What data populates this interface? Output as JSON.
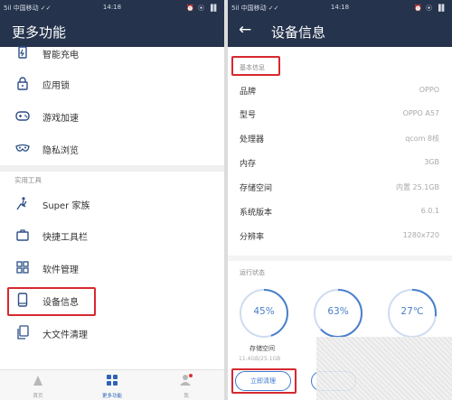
{
  "statusbar": {
    "carrier": "5il 中国移动 ✓✓",
    "time": "14:18",
    "icons": "⏰ ⦿ ▐▌"
  },
  "left": {
    "title": "更多功能",
    "items_top": [
      {
        "icon": "charge-icon",
        "label": "智能充电"
      },
      {
        "icon": "lock-icon",
        "label": "应用锁"
      },
      {
        "icon": "gamepad-icon",
        "label": "游戏加速"
      },
      {
        "icon": "mask-icon",
        "label": "隐私浏览"
      }
    ],
    "section": "实用工具",
    "items_tools": [
      {
        "icon": "family-icon",
        "label": "Super 家族"
      },
      {
        "icon": "toolbox-icon",
        "label": "快捷工具栏"
      },
      {
        "icon": "grid-icon",
        "label": "软件管理"
      },
      {
        "icon": "phone-icon",
        "label": "设备信息"
      },
      {
        "icon": "files-icon",
        "label": "大文件清理"
      }
    ],
    "bottom_nav": [
      {
        "icon": "home-icon",
        "label": "首页"
      },
      {
        "icon": "apps-icon",
        "label": "更多功能"
      },
      {
        "icon": "user-icon",
        "label": "我"
      }
    ],
    "colors": {
      "header": "#25334c",
      "accent": "#2d63b8",
      "highlight": "#d7282f"
    }
  },
  "right": {
    "title": "设备信息",
    "back_icon": "back-arrow-icon",
    "basic_label": "基本信息",
    "rows": [
      {
        "key": "品牌",
        "value": "OPPO"
      },
      {
        "key": "型号",
        "value": "OPPO A57"
      },
      {
        "key": "处理器",
        "value": "qcom 8核"
      },
      {
        "key": "内存",
        "value": "3GB"
      },
      {
        "key": "存储空间",
        "value": "内置 25.1GB"
      },
      {
        "key": "系统版本",
        "value": "6.0.1"
      },
      {
        "key": "分辨率",
        "value": "1280x720"
      }
    ],
    "run_label": "运行状态",
    "gauges": [
      {
        "text": "45%",
        "fraction": 0.45
      },
      {
        "text": "63%",
        "fraction": 0.63
      },
      {
        "text": "27℃",
        "fraction": 0.27
      }
    ],
    "storage_label": "存储空间",
    "storage_value": "11.4GB/25.1GB",
    "clean_button": "立即清理"
  }
}
